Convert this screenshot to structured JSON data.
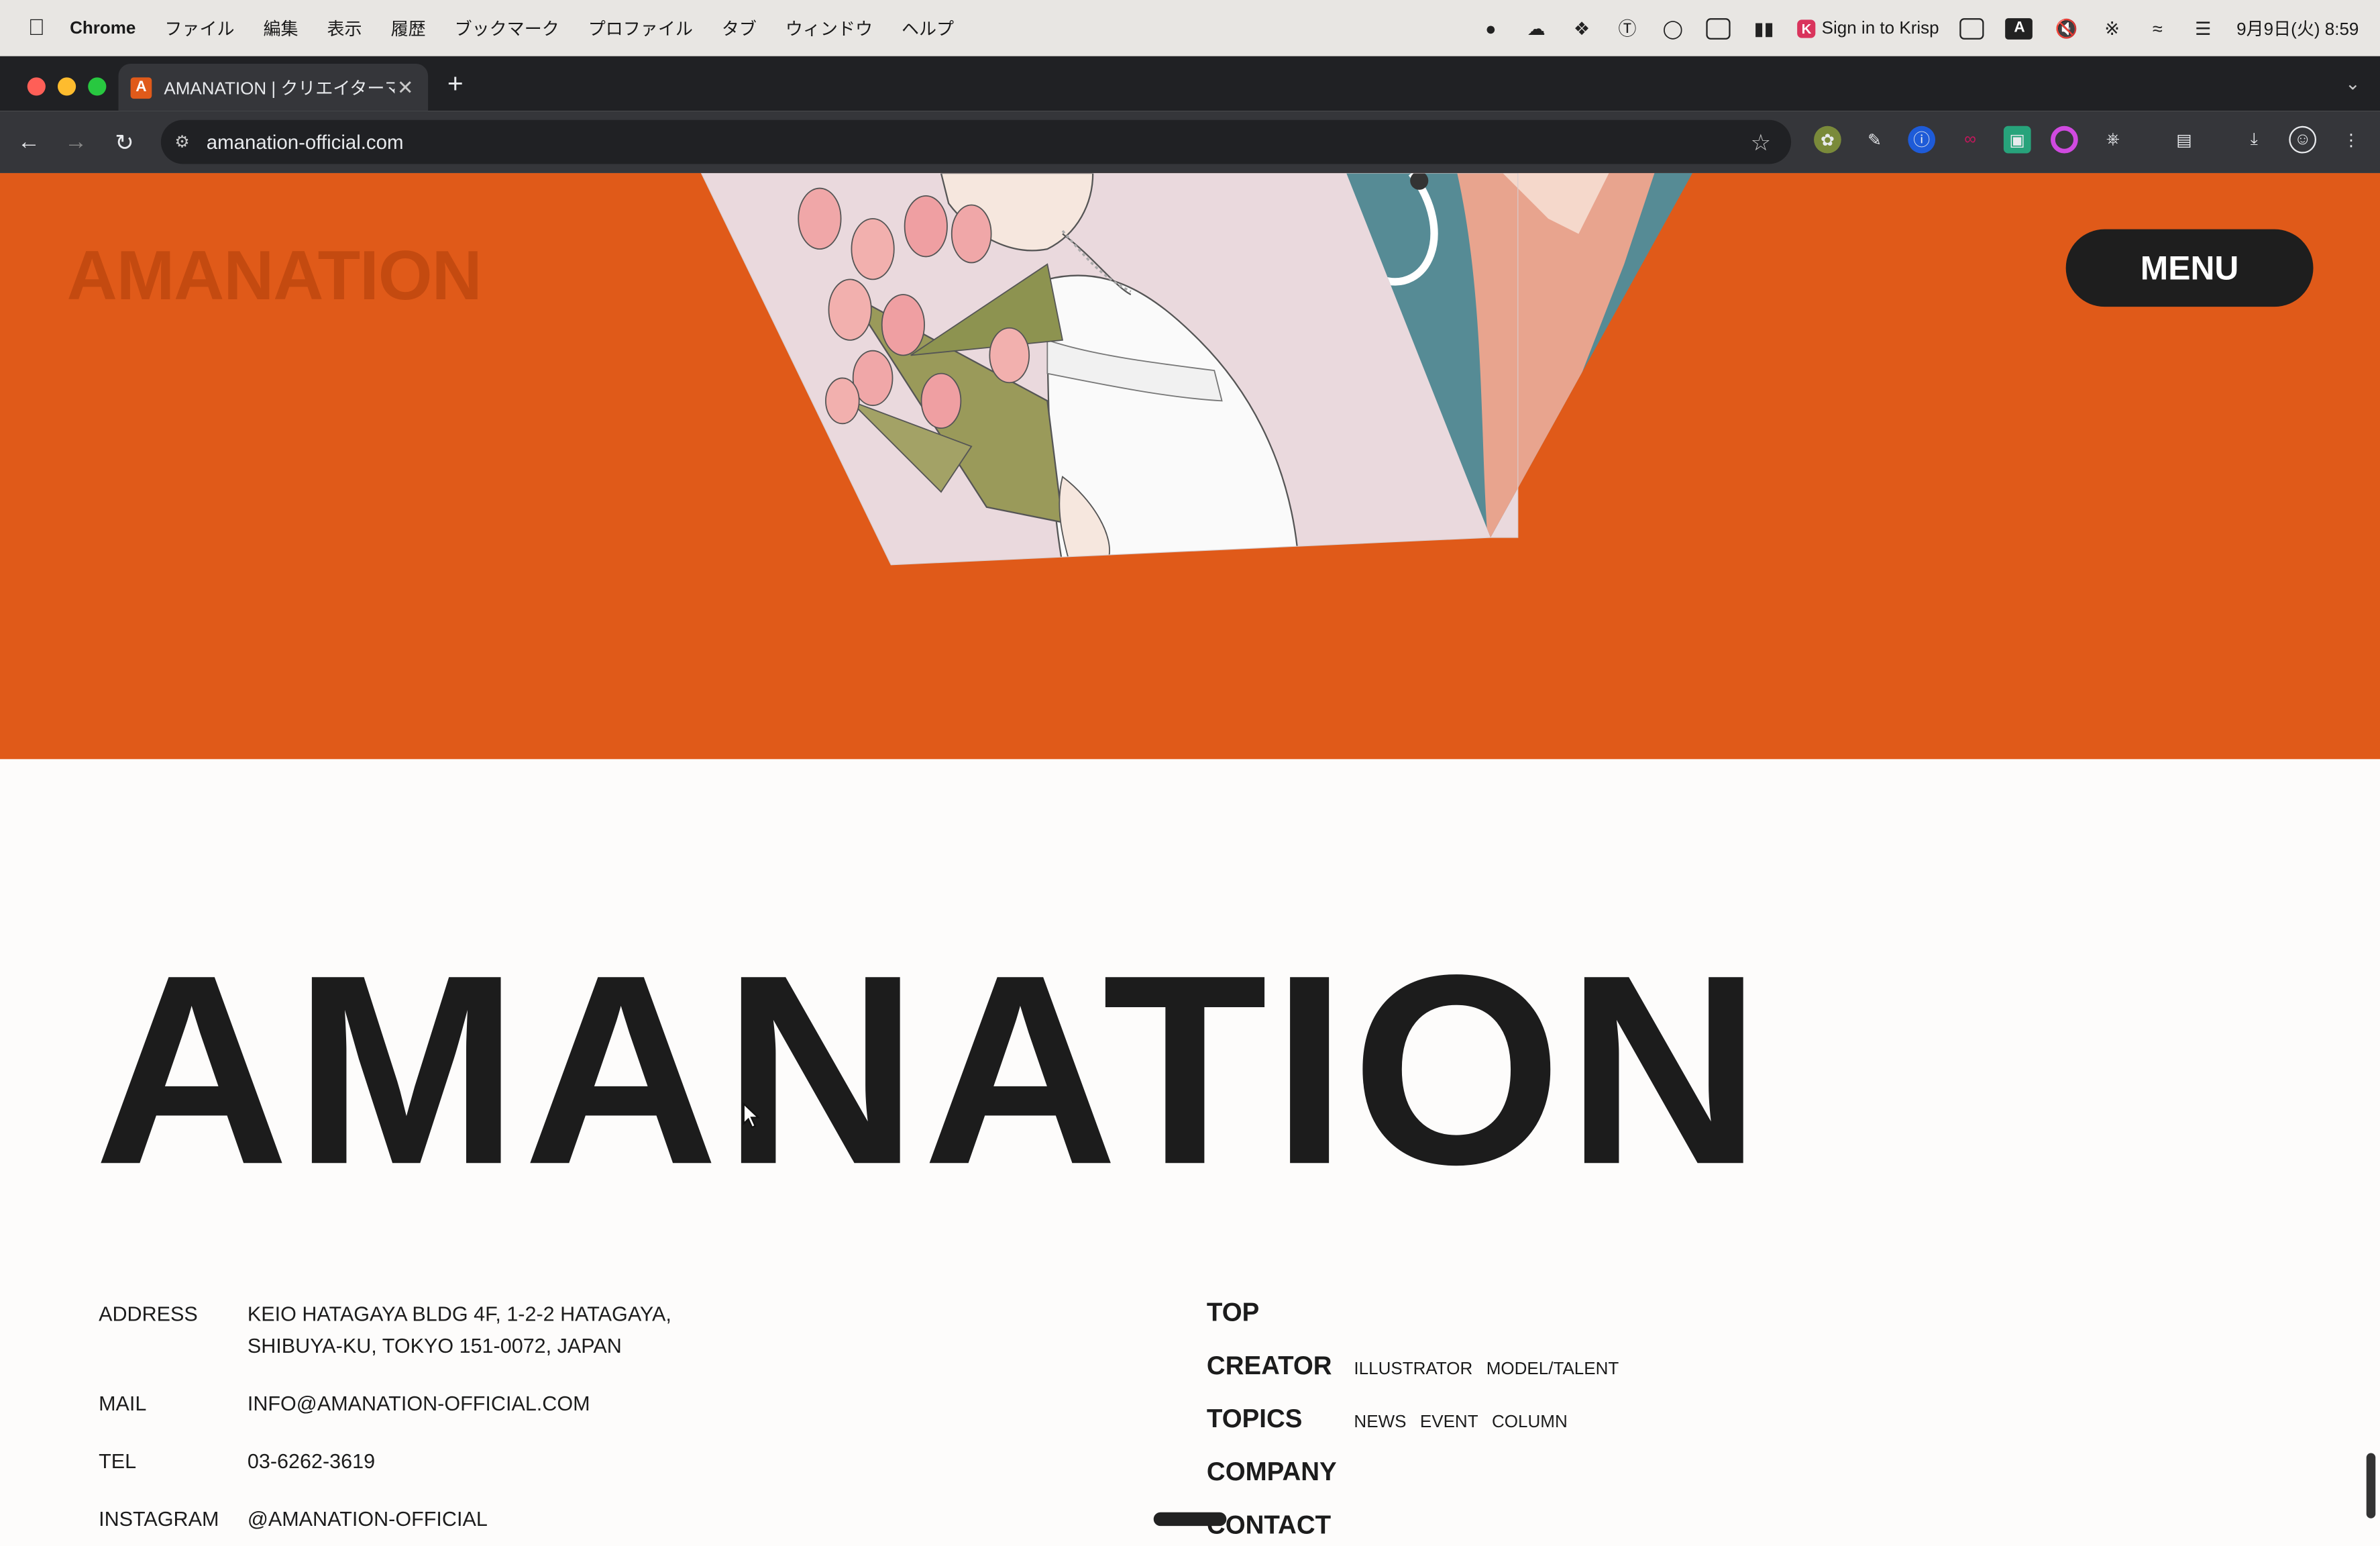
{
  "menubar": {
    "app": "Chrome",
    "items": [
      "ファイル",
      "編集",
      "表示",
      "履歴",
      "ブックマーク",
      "プロファイル",
      "タブ",
      "ウィンドウ",
      "ヘルプ"
    ],
    "krisp": "Sign in to Krisp",
    "input_badge": "A",
    "datetime": "9月9日(火) 8:59"
  },
  "browser": {
    "tab_title": "AMANATION | クリエイターマ",
    "tab_favicon": "A",
    "url": "amanation-official.com"
  },
  "hero": {
    "logo": "AMANATION",
    "menu_label": "MENU",
    "background_color": "#e05a19"
  },
  "footer": {
    "big_logo": "AMANATION",
    "info": [
      {
        "label": "ADDRESS",
        "value": "KEIO HATAGAYA BLDG 4F, 1-2-2 HATAGAYA,\nSHIBUYA-KU, TOKYO 151-0072, JAPAN"
      },
      {
        "label": "MAIL",
        "value": "INFO@AMANATION-OFFICIAL.COM"
      },
      {
        "label": "TEL",
        "value": "03-6262-3619"
      },
      {
        "label": "INSTAGRAM",
        "value": "@AMANATION-OFFICIAL"
      }
    ],
    "nav": {
      "top": "TOP",
      "creator": "CREATOR",
      "creator_sub": [
        "ILLUSTRATOR",
        "MODEL/TALENT"
      ],
      "topics": "TOPICS",
      "topics_sub": [
        "NEWS",
        "EVENT",
        "COLUMN"
      ],
      "company": "COMPANY",
      "contact": "CONTACT"
    }
  }
}
